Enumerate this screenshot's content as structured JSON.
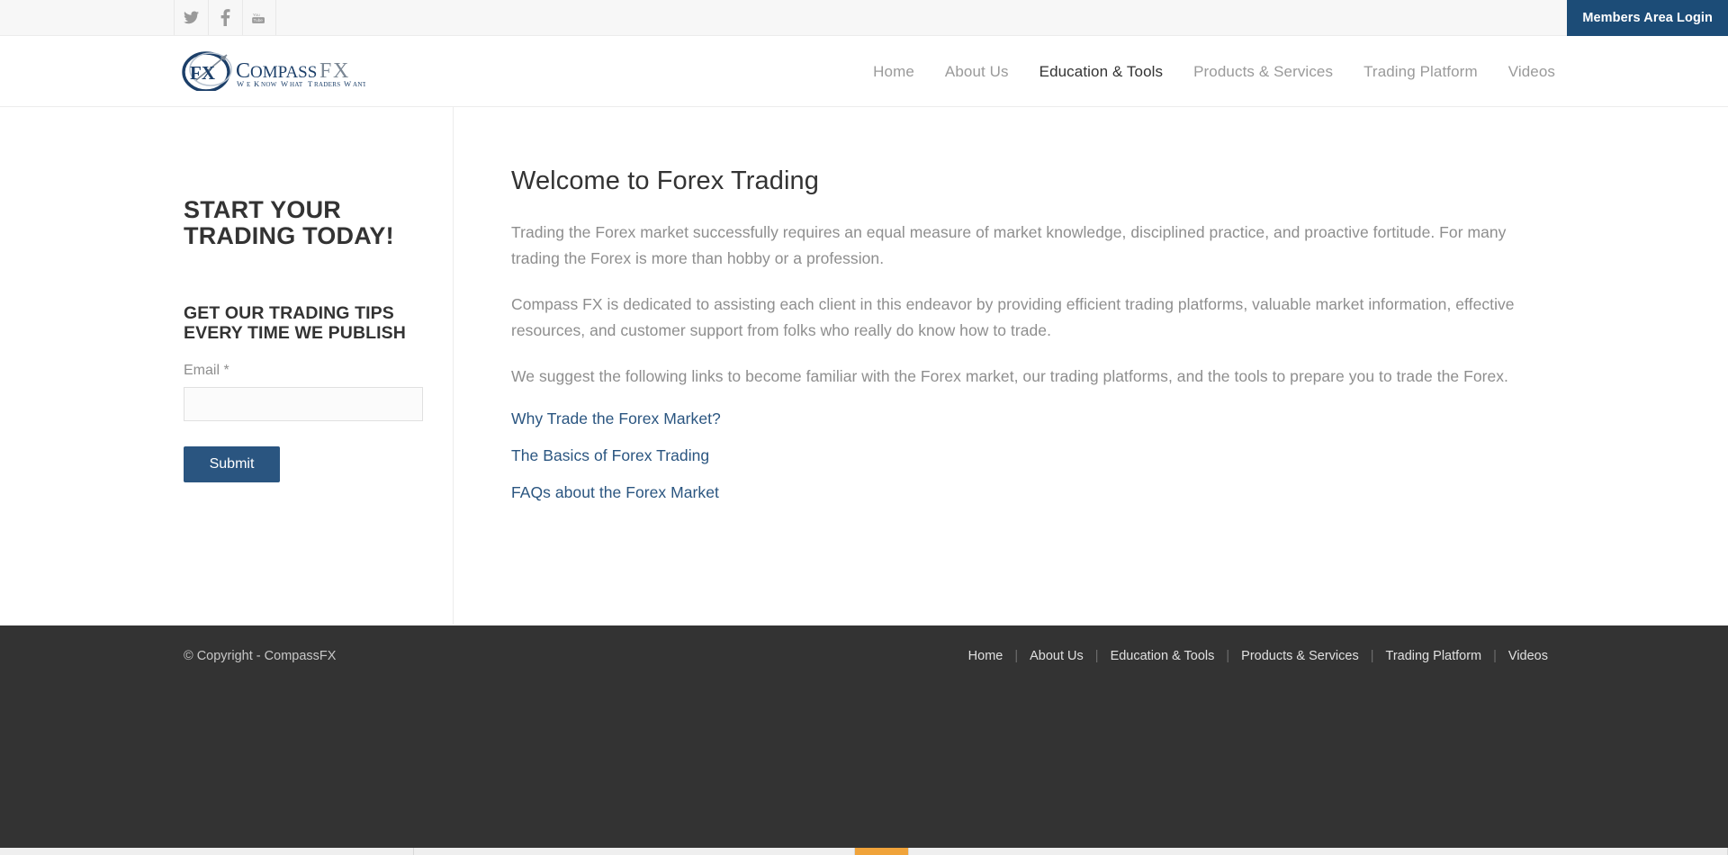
{
  "topbar": {
    "social": [
      {
        "name": "twitter-icon",
        "label": "Twitter"
      },
      {
        "name": "facebook-icon",
        "label": "Facebook"
      },
      {
        "name": "youtube-icon",
        "label": "YouTube"
      }
    ],
    "members_login_label": "Members Area Login",
    "members_login_bg": "#1c4c77"
  },
  "header": {
    "logo_mark": "FX",
    "logo_name_1": "Compass",
    "logo_name_2": "FX",
    "logo_tagline": "We Know What Traders Want",
    "nav": [
      {
        "label": "Home",
        "active": false
      },
      {
        "label": "About Us",
        "active": false
      },
      {
        "label": "Education & Tools",
        "active": true
      },
      {
        "label": "Products & Services",
        "active": false
      },
      {
        "label": "Trading Platform",
        "active": false
      },
      {
        "label": "Videos",
        "active": false
      }
    ]
  },
  "sidebar": {
    "headline": "START YOUR TRADING TODAY!",
    "subhead": "GET OUR TRADING TIPS EVERY TIME WE PUBLISH",
    "email_label": "Email",
    "email_required_mark": "*",
    "email_value": "",
    "email_placeholder": "",
    "submit_label": "Submit",
    "submit_bg": "#2a5580"
  },
  "main": {
    "title": "Welcome to Forex Trading",
    "paragraphs": [
      "Trading the Forex market successfully requires an equal measure of market knowledge, disciplined practice, and proactive fortitude.  For many trading the Forex is more than hobby or a profession.",
      "Compass FX is dedicated to assisting each client in this endeavor by providing efficient trading platforms, valuable market information, effective resources, and customer support from folks who really do know how to trade.",
      "We suggest the following links to become familiar with the Forex market, our trading platforms, and the tools to prepare you to trade the Forex."
    ],
    "links": [
      "Why Trade the Forex Market?",
      "The Basics of Forex Trading",
      "FAQs about the Forex Market"
    ],
    "link_color": "#2a5580"
  },
  "footer": {
    "copyright": "© Copyright - CompassFX",
    "nav": [
      "Home",
      "About Us",
      "Education & Tools",
      "Products & Services",
      "Trading Platform",
      "Videos"
    ],
    "separator": "|",
    "bg": "#333333"
  }
}
